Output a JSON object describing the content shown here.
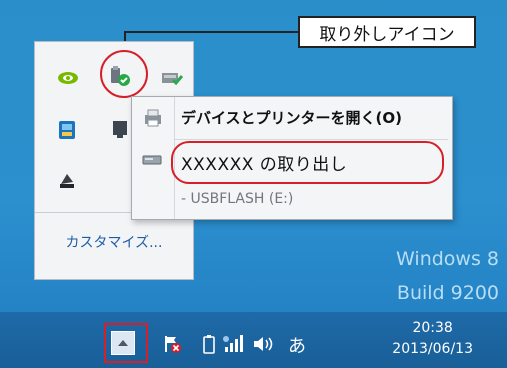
{
  "callout": {
    "label": "取り外しアイコン"
  },
  "tray": {
    "customize_label": "カスタマイズ...",
    "icons": [
      "nvidia-icon",
      "safely-remove-hardware-icon",
      "driver-update-icon",
      "app-icon",
      "monitor-icon",
      "network-icon"
    ]
  },
  "menu": {
    "open_devices": "デバイスとプリンターを開く(O)",
    "eject": "XXXXXX の取り出し",
    "drive": "-   USBFLASH (E:)"
  },
  "desktop": {
    "watermark_line1": "Windows 8",
    "watermark_line2": "Build 9200"
  },
  "taskbar": {
    "ime": "あ",
    "time": "20:38",
    "date": "2013/06/13"
  },
  "colors": {
    "desktop": "#2a8fc9",
    "taskbar": "#1e6aa8",
    "highlight": "#d71f2a",
    "link": "#1d5da8"
  }
}
